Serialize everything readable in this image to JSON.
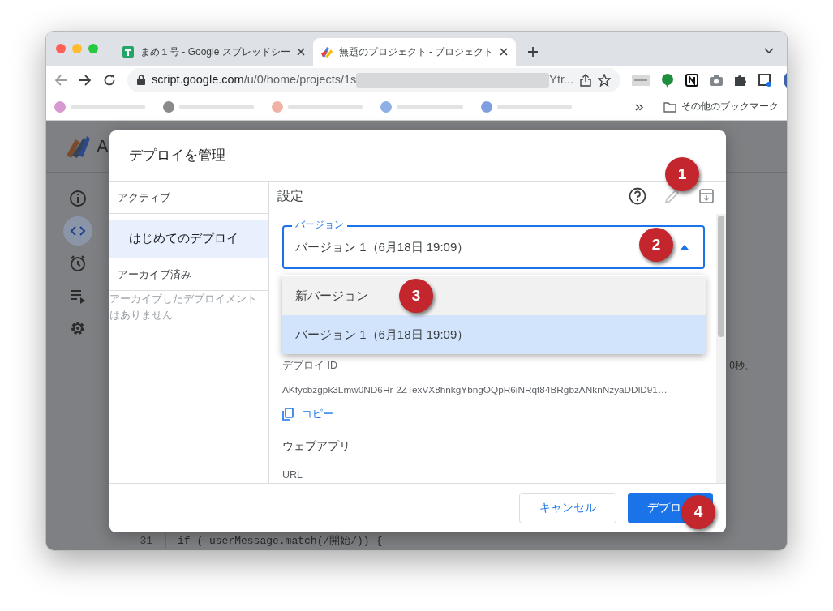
{
  "browser": {
    "tabs": [
      {
        "kind": "sheets",
        "title": "まめ１号 - Google スプレッドシー",
        "selected": false
      },
      {
        "kind": "script",
        "title": "無題のプロジェクト - プロジェクト",
        "selected": true
      }
    ],
    "url": {
      "host": "script.google.com",
      "path": "/u/0/home/projects/1s",
      "tail": "Ytr..."
    },
    "other_bookmarks": "その他のブックマーク"
  },
  "app": {
    "logo_text": "A",
    "sidebar": [
      {
        "kind": "info",
        "selected": false
      },
      {
        "kind": "code",
        "selected": true
      },
      {
        "kind": "clock",
        "selected": false
      },
      {
        "kind": "runs",
        "selected": false
      },
      {
        "kind": "gear",
        "selected": false
      }
    ],
    "side_text": "0秒、",
    "line_number": "31",
    "code_line": "if ( userMessage.match(/開始/)) {"
  },
  "dialog": {
    "title": "デプロイを管理",
    "left": {
      "active_heading": "アクティブ",
      "deployments": [
        {
          "name": "はじめてのデプロイ",
          "selected": true
        }
      ],
      "archived_heading": "アーカイブ済み",
      "archived_empty": "アーカイブしたデプロイメントはありません"
    },
    "settings": {
      "heading": "設定",
      "tools": [
        {
          "kind": "help",
          "disabled": false
        },
        {
          "kind": "edit",
          "disabled": true
        },
        {
          "kind": "archive",
          "disabled": false
        }
      ],
      "version_field": {
        "label": "バージョン",
        "value": "バージョン 1（6月18日 19:09）",
        "expanded": true
      },
      "version_options": [
        {
          "label": "新バージョン",
          "selected": false,
          "hovered": true
        },
        {
          "label": "バージョン 1（6月18日 19:09）",
          "selected": true,
          "hovered": false
        }
      ],
      "deploy_id_label": "デプロイ ID",
      "deploy_id": "AKfycbzgpk3Lmw0ND6Hr-2ZTexVX8hnkgYbngOQpR6iNRqt84BRgbzANknNzyaDDlD91…",
      "copy_link": "コピー",
      "webapp_heading": "ウェブアプリ",
      "url_label": "URL"
    },
    "buttons": [
      {
        "kind": "secondary",
        "label": "キャンセル"
      },
      {
        "kind": "primary",
        "label": "デプロ"
      }
    ]
  },
  "markers": [
    "1",
    "2",
    "3",
    "4"
  ]
}
